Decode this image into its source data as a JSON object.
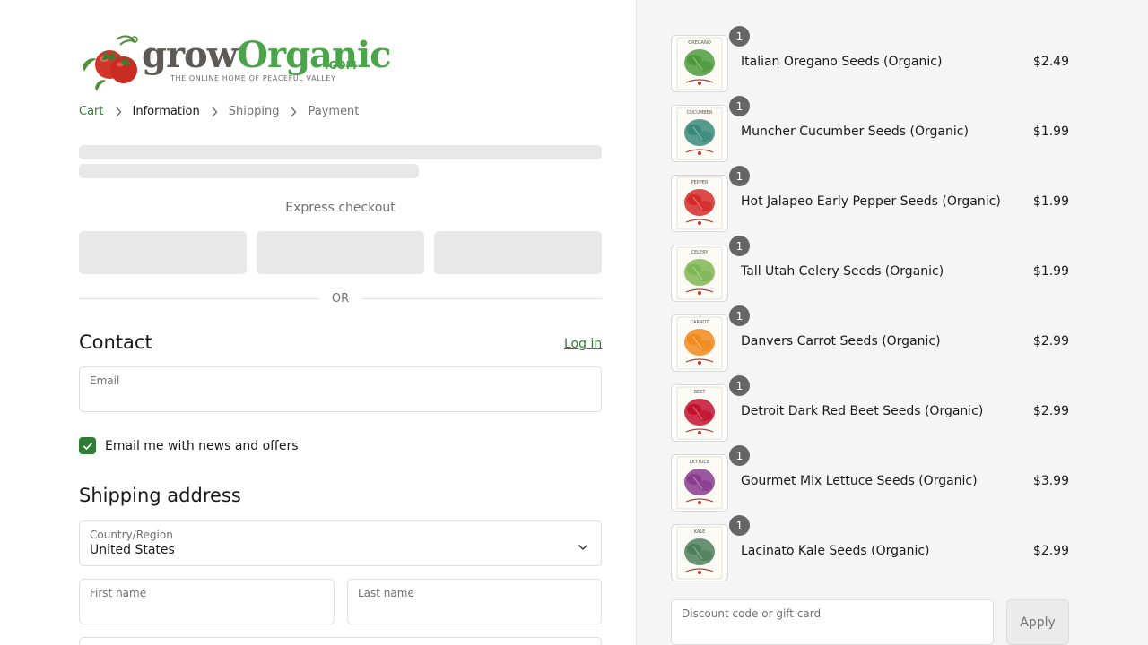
{
  "logo": {
    "word_a": "grow",
    "word_b": "Organic",
    "dotcom": ".COM",
    "tagline": "THE ONLINE HOME OF PEACEFUL VALLEY",
    "icon": "tomato-icon"
  },
  "breadcrumb": {
    "items": [
      "Cart",
      "Information",
      "Shipping",
      "Payment"
    ],
    "separator_icon": "chevron-right-icon"
  },
  "express": {
    "title": "Express checkout",
    "or_label": "OR"
  },
  "contact": {
    "title": "Contact",
    "login_label": "Log in",
    "email_label": "Email",
    "newsletter_label": "Email me with news and offers",
    "newsletter_checked": true
  },
  "shipping": {
    "title": "Shipping address",
    "country_label": "Country/Region",
    "country_value": "United States",
    "first_name_label": "First name",
    "last_name_label": "Last name"
  },
  "cart": {
    "items": [
      {
        "name": "Italian Oregano Seeds (Organic)",
        "price": "$2.49",
        "qty": "1",
        "packet_label": "OREGANO",
        "color": "#4d9a3e"
      },
      {
        "name": "Muncher Cucumber Seeds (Organic)",
        "price": "$1.99",
        "qty": "1",
        "packet_label": "CUCUMBER",
        "color": "#3a8a7a"
      },
      {
        "name": "Hot Jalapeo Early Pepper Seeds (Organic)",
        "price": "$1.99",
        "qty": "1",
        "packet_label": "PEPPER",
        "color": "#d42a2a"
      },
      {
        "name": "Tall Utah Celery Seeds (Organic)",
        "price": "$1.99",
        "qty": "1",
        "packet_label": "CELERY",
        "color": "#7fb552"
      },
      {
        "name": "Danvers Carrot Seeds (Organic)",
        "price": "$2.99",
        "qty": "1",
        "packet_label": "CARROT",
        "color": "#f08a1c"
      },
      {
        "name": "Detroit Dark Red Beet Seeds (Organic)",
        "price": "$2.99",
        "qty": "1",
        "packet_label": "BEET",
        "color": "#c3122f"
      },
      {
        "name": "Gourmet Mix Lettuce Seeds (Organic)",
        "price": "$3.99",
        "qty": "1",
        "packet_label": "LETTUCE",
        "color": "#8a3b8f"
      },
      {
        "name": "Lacinato Kale Seeds (Organic)",
        "price": "$2.99",
        "qty": "1",
        "packet_label": "KALE",
        "color": "#4f7f5a"
      }
    ],
    "discount_label": "Discount code or gift card",
    "apply_label": "Apply"
  },
  "colors": {
    "accent": "#2e7d32",
    "logo_green": "#4ba44a",
    "logo_gray": "#5d5a55",
    "skeleton": "#e8e8e8",
    "summary_bg": "#f5f5f5"
  }
}
